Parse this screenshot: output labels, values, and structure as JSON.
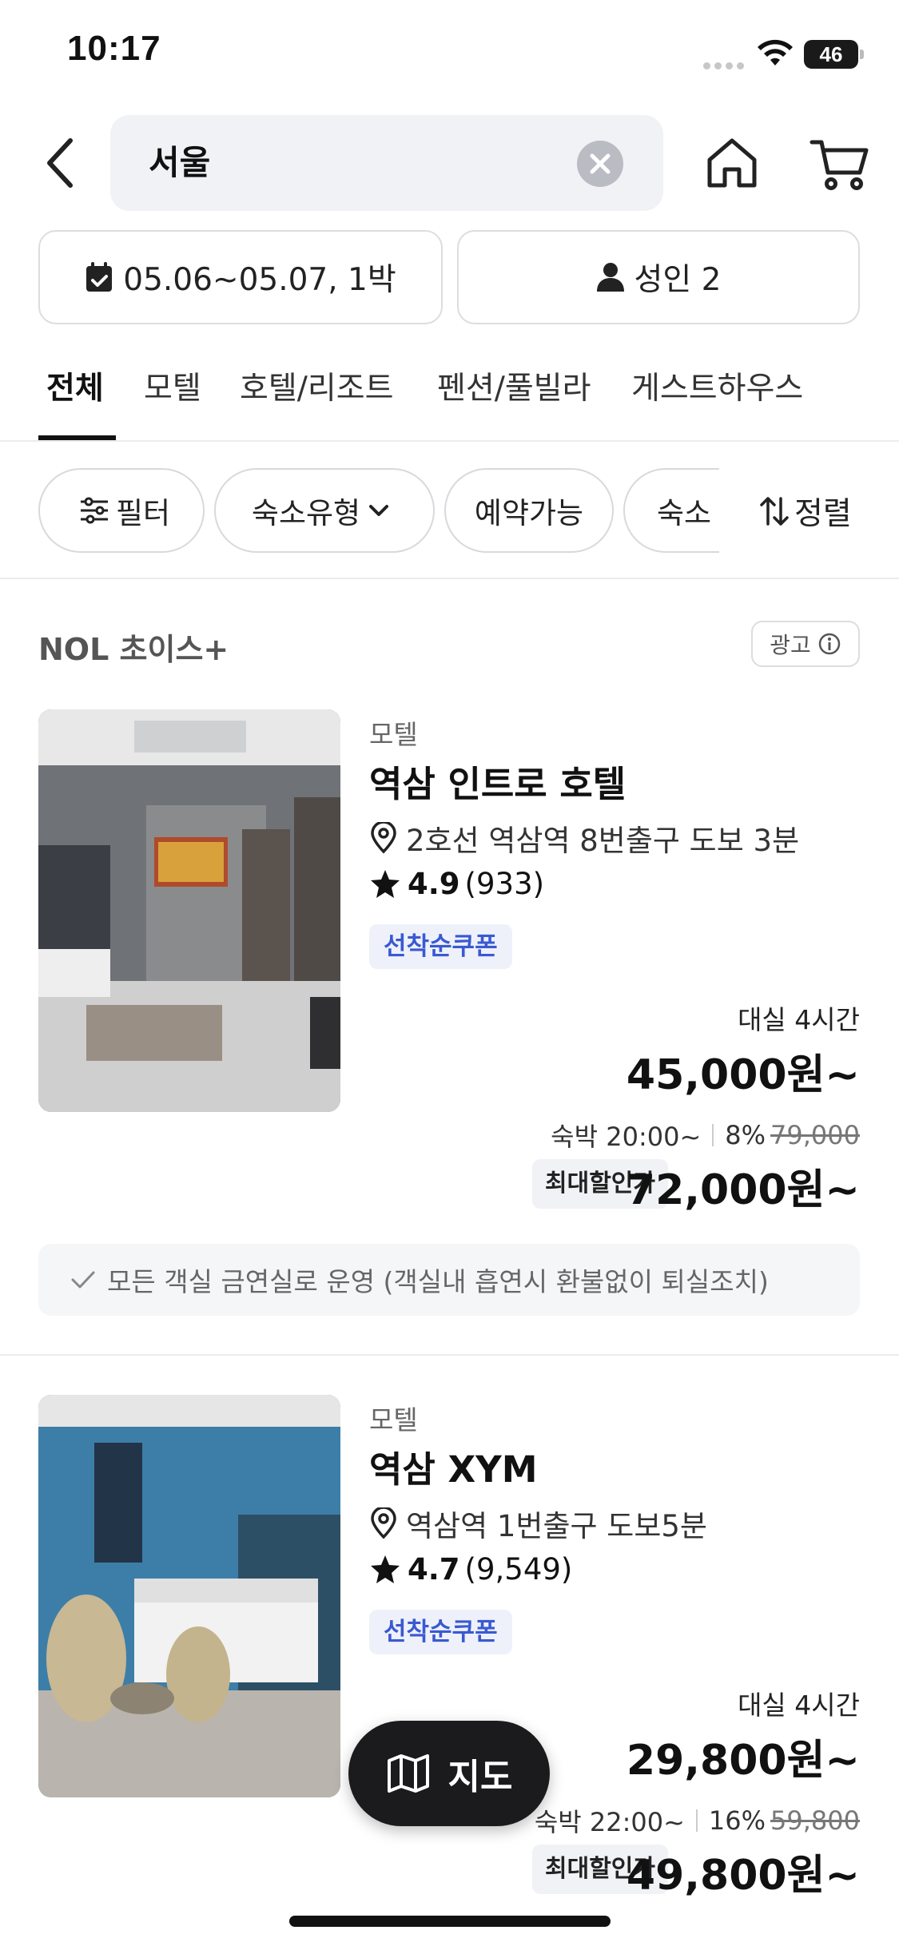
{
  "status_bar": {
    "time": "10:17",
    "battery": "46"
  },
  "search": {
    "query": "서울"
  },
  "booking": {
    "dates": "05.06~05.07, 1박",
    "guests": "성인 2"
  },
  "tabs": [
    {
      "label": "전체",
      "active": true
    },
    {
      "label": "모텔"
    },
    {
      "label": "호텔/리조트"
    },
    {
      "label": "펜션/풀빌라"
    },
    {
      "label": "게스트하우스"
    }
  ],
  "filters": {
    "chips": [
      "필터",
      "숙소유형",
      "예약가능",
      "숙소"
    ],
    "sort_label": "정렬"
  },
  "section": {
    "title": "NOL 초이스+",
    "ad_label": "광고"
  },
  "listings": [
    {
      "category": "모텔",
      "name": "역삼 인트로 호텔",
      "location": "2호선 역삼역 8번출구 도보 3분",
      "rating": "4.9",
      "reviews": "(933)",
      "coupon": "선착순쿠폰",
      "rent_label": "대실 4시간",
      "rent_price": "45,000원~",
      "stay_label": "숙박 20:00~",
      "discount": "8%",
      "original_price": "79,000",
      "max_discount_label": "최대할인가",
      "stay_price": "72,000원~",
      "notice": "모든 객실 금연실로 운영 (객실내 흡연시 환불없이 퇴실조치)"
    },
    {
      "category": "모텔",
      "name": "역삼 XYM",
      "location": "역삼역 1번출구 도보5분",
      "rating": "4.7",
      "reviews": "(9,549)",
      "coupon": "선착순쿠폰",
      "rent_label": "대실 4시간",
      "rent_price": "29,800원~",
      "stay_label": "숙박 22:00~",
      "discount": "16%",
      "original_price": "59,800",
      "max_discount_label": "최대할인가",
      "stay_price": "49,800원~"
    }
  ],
  "map_button": {
    "label": "지도"
  },
  "colors": {
    "accent_blue": "#3a59d1",
    "coupon_bg": "#eef1fa",
    "dark": "#1b1b1d"
  }
}
